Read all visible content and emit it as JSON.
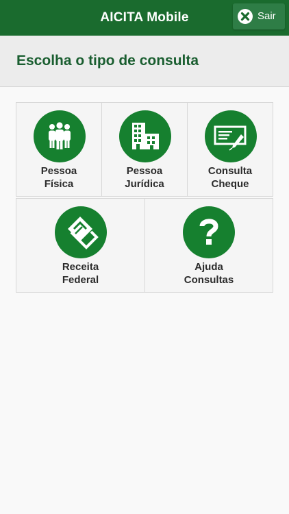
{
  "header": {
    "title": "AICITA Mobile",
    "exit_label": "Sair",
    "exit_icon": "close-circle-icon"
  },
  "subheader": {
    "title": "Escolha o tipo de consulta"
  },
  "colors": {
    "brand_green": "#1a6b2e",
    "icon_circle": "#16802f",
    "title_green": "#1a5e30"
  },
  "options": [
    {
      "line1": "Pessoa",
      "line2": "Física",
      "icon": "people-icon"
    },
    {
      "line1": "Pessoa",
      "line2": "Jurídica",
      "icon": "buildings-icon"
    },
    {
      "line1": "Consulta",
      "line2": "Cheque",
      "icon": "check-pen-icon"
    },
    {
      "line1": "Receita",
      "line2": "Federal",
      "icon": "receita-federal-logo-icon"
    },
    {
      "line1": "Ajuda",
      "line2": "Consultas",
      "icon": "question-mark-icon"
    }
  ]
}
